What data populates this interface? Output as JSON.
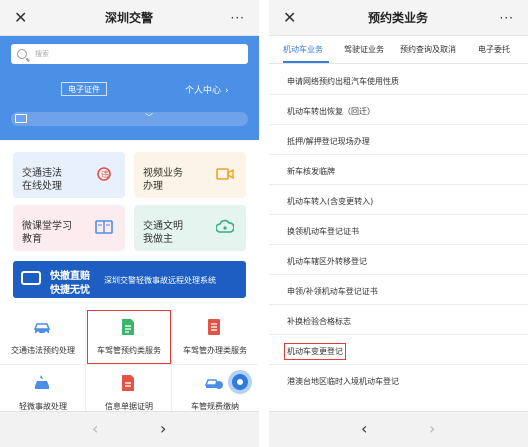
{
  "left": {
    "title": "深圳交警",
    "close": "✕",
    "more": "···",
    "search_placeholder": "搜索",
    "cert_label": "电子证件",
    "personal_center": "个人中心",
    "personal_center_chev": "›",
    "id_arrow": "﹀",
    "tiles": [
      {
        "line1": "交通违法",
        "line2": "在线处理",
        "icon_color": "#e05545"
      },
      {
        "line1": "视频业务",
        "line2": "办理",
        "icon_color": "#f0a22c"
      },
      {
        "line1": "微课堂学习",
        "line2": "教育",
        "icon_color": "#4c8fe6"
      },
      {
        "line1": "交通文明",
        "line2": "我做主",
        "icon_color": "#2fae84"
      }
    ],
    "banner": {
      "line1": "快撤直赔",
      "line2": "快捷无忧",
      "desc": "深圳交警轻微事故远程处理系统"
    },
    "grid": [
      {
        "label": "交通违法预约处理",
        "icon_color": "#4c8fe6"
      },
      {
        "label": "车驾管预约类服务",
        "icon_color": "#3ab56a"
      },
      {
        "label": "车驾管办理类服务",
        "icon_color": "#e05545"
      },
      {
        "label": "轻微事故处理",
        "icon_color": "#4c8fe6"
      },
      {
        "label": "信息单据证明",
        "icon_color": "#e05545"
      },
      {
        "label": "车管规费缴纳",
        "icon_color": "#4c8fe6"
      }
    ],
    "nav_back": "‹",
    "nav_forward": "›"
  },
  "right": {
    "title": "预约类业务",
    "close": "✕",
    "more": "···",
    "tabs": [
      "机动车业务",
      "驾驶证业务",
      "预约查询及取消",
      "电子委托"
    ],
    "items": [
      "申请网络预约出租汽车使用性质",
      "机动车转出恢复（回迁）",
      "抵押/解押登记现场办理",
      "新车核发临牌",
      "机动车转入(含变更转入)",
      "换领机动车登记证书",
      "机动车辖区外转移登记",
      "申领/补领机动车登记证书",
      "补换检验合格标志",
      "机动车变更登记",
      "港澳台地区临时入境机动车登记"
    ],
    "nav_back": "‹",
    "nav_forward": "›"
  },
  "colors": {
    "primary_blue": "#4c8fe6",
    "tab_active": "#3a7fe0",
    "highlight": "#e23b3b"
  }
}
